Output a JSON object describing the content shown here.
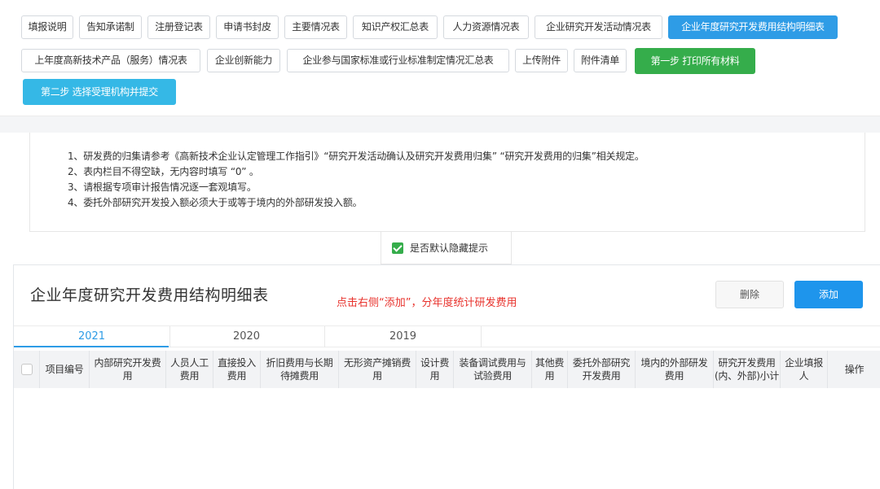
{
  "nav": {
    "tabs": [
      "填报说明",
      "告知承诺制",
      "注册登记表",
      "申请书封皮",
      "主要情况表",
      "知识产权汇总表",
      "人力资源情况表",
      "企业研究开发活动情况表",
      "企业年度研究开发费用结构明细表",
      "上年度高新技术产品（服务）情况表",
      "企业创新能力",
      "企业参与国家标准或行业标准制定情况汇总表",
      "上传附件",
      "附件清单"
    ],
    "active_tab": "企业年度研究开发费用结构明细表",
    "step1_label": "第一步 打印所有材料",
    "step2_label": "第二步 选择受理机构并提交"
  },
  "notes": [
    "1、研发费的归集请参考《高新技术企业认定管理工作指引》“研究开发活动确认及研究开发费用归集” “研究开发费用的归集”相关规定。",
    "2、表内栏目不得空缺，无内容时填写 “0” 。",
    "3、请根据专项审计报告情况逐一套观填写。",
    "4、委托外部研究开发投入额必须大于或等于境内的外部研发投入额。"
  ],
  "hide_tips_toggle": {
    "label": "是否默认隐藏提示",
    "checked": true
  },
  "panel": {
    "title": "企业年度研究开发费用结构明细表",
    "hint": "点击右侧“添加”，分年度统计研发费用",
    "delete_label": "删除",
    "add_label": "添加"
  },
  "years": [
    "2021",
    "2020",
    "2019"
  ],
  "active_year": "2021",
  "table": {
    "columns": [
      "项目编号",
      "内部研究开发费用",
      "人员人工费用",
      "直接投入费用",
      "折旧费用与长期待摊费用",
      "无形资产摊销费用",
      "设计费用",
      "装备调试费用与试验费用",
      "其他费用",
      "委托外部研究开发费用",
      "境内的外部研发费用",
      "研究开发费用(内、外部)小计",
      "企业填报人",
      "操作"
    ]
  },
  "colors": {
    "active_tab": "#2e9ce6",
    "step1": "#35ad4b",
    "step2": "#35b8e6",
    "add_button": "#1e95ec",
    "hint": "#e8332d"
  }
}
